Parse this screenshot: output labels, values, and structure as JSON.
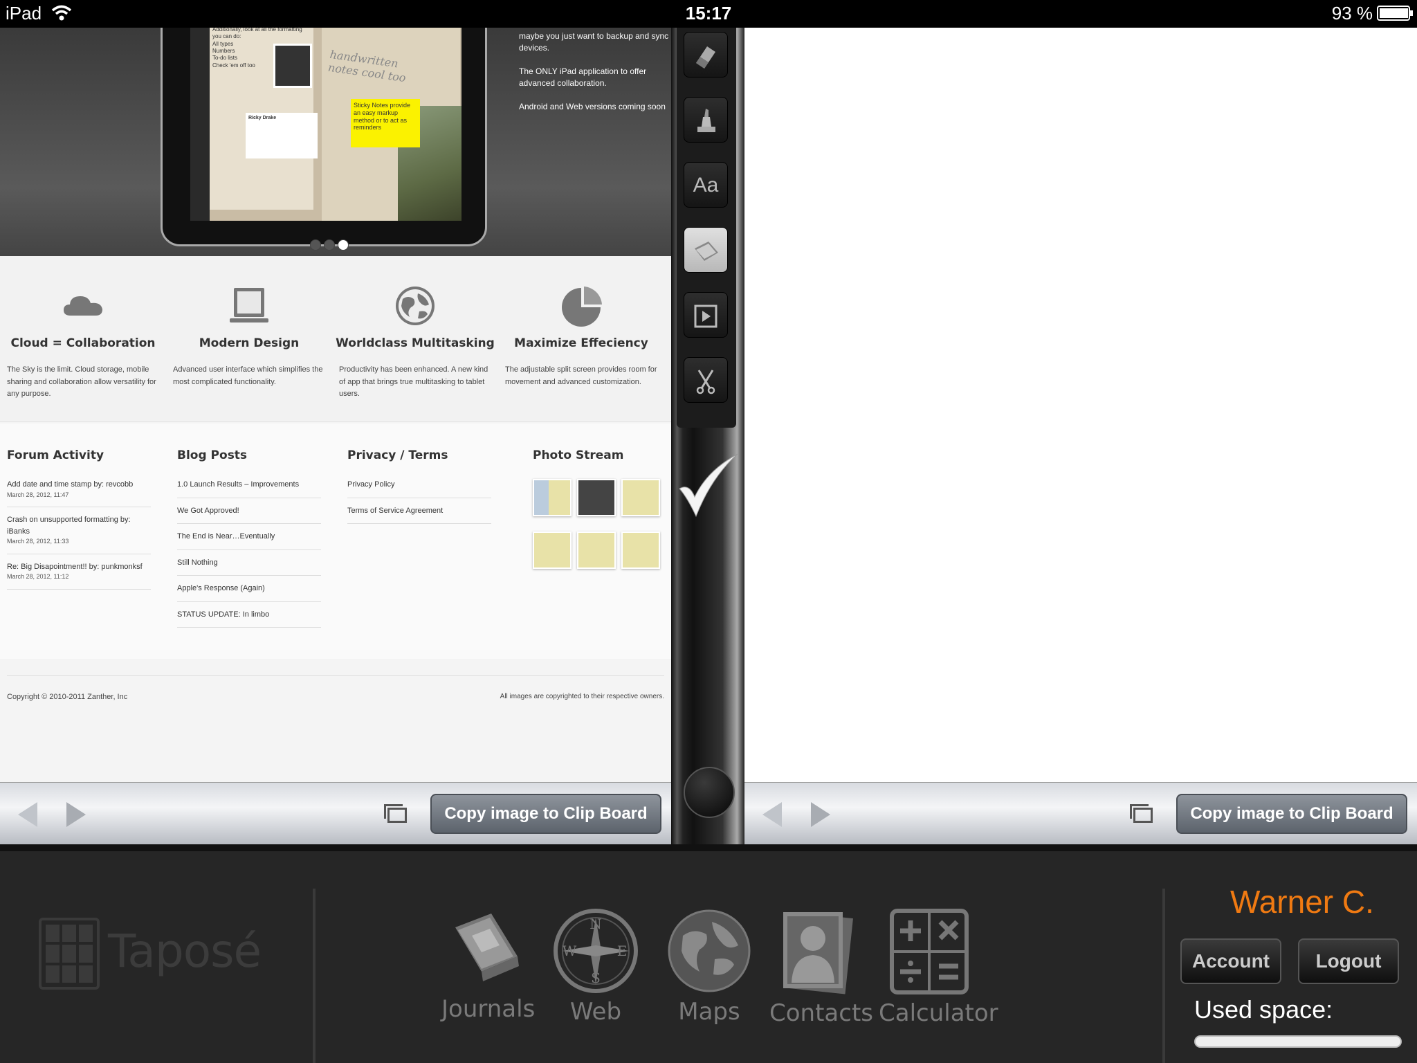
{
  "status_bar": {
    "device": "iPad",
    "time": "15:17",
    "battery_percent": "93 %",
    "battery_level": 0.93
  },
  "hero": {
    "text_lines": [
      "maybe you just want to backup and sync devices.",
      "The ONLY iPad application to offer advanced collaboration.",
      "Android and Web versions coming soon"
    ],
    "screen_page_text": "The Taposé word processor is one of the most powerful on the iPad. Additionally, look at all the formatting you can do:",
    "screen_list": [
      "All types",
      "Numbers",
      "To-do lists",
      "Check 'em off too"
    ],
    "screen_handwriting": "handwritten notes cool too",
    "screen_sticky": "Sticky Notes provide an easy markup method or to act as reminders",
    "screen_card_name": "Ricky Drake",
    "slide_count": 3,
    "active_slide": 3
  },
  "features": [
    {
      "title": "Cloud = Collaboration",
      "text": "The Sky is the limit. Cloud storage, mobile sharing and collaboration allow versatility for any purpose.",
      "icon": "cloud-icon"
    },
    {
      "title": "Modern Design",
      "text": "Advanced user interface which simplifies the most complicated functionality.",
      "icon": "laptop-icon"
    },
    {
      "title": "Worldclass Multitasking",
      "text": "Productivity has been enhanced. A new kind of app that brings true multitasking to tablet users.",
      "icon": "globe-icon"
    },
    {
      "title": "Maximize Effeciency",
      "text": "The adjustable split screen provides room for movement and advanced customization.",
      "icon": "pie-chart-icon"
    }
  ],
  "forum": {
    "heading": "Forum Activity",
    "items": [
      {
        "text": "Add date and time stamp by: revcobb",
        "time": "March 28, 2012, 11:47"
      },
      {
        "text": "Crash on unsupported formatting by: iBanks",
        "time": "March 28, 2012, 11:33"
      },
      {
        "text": "Re: Big Disapointment!! by: punkmonksf",
        "time": "March 28, 2012, 11:12"
      }
    ]
  },
  "blog": {
    "heading": "Blog Posts",
    "items": [
      "1.0 Launch Results – Improvements",
      "We Got Approved!",
      "The End is Near…Eventually",
      "Still Nothing",
      "Apple's Response (Again)",
      "STATUS UPDATE: In limbo"
    ]
  },
  "privacy": {
    "heading": "Privacy / Terms",
    "items": [
      "Privacy Policy",
      "Terms of Service Agreement"
    ]
  },
  "photo_stream": {
    "heading": "Photo Stream"
  },
  "footer": {
    "copyright": "Copyright © 2010-2011 Zanther, Inc",
    "rights": "All images are copyrighted to their respective owners."
  },
  "pane_toolbar": {
    "copy_label": "Copy image to Clip Board"
  },
  "tools": [
    "eraser-icon",
    "highlighter-icon",
    "text-tool-icon",
    "note-tool-icon",
    "media-tool-icon",
    "scissors-icon"
  ],
  "tool_text_label": "Aa",
  "dock": {
    "apps": [
      {
        "label": "Journals",
        "icon": "journals-icon"
      },
      {
        "label": "Web",
        "icon": "compass-icon"
      },
      {
        "label": "Maps",
        "icon": "globe-icon"
      },
      {
        "label": "Contacts",
        "icon": "contacts-icon"
      },
      {
        "label": "Calculator",
        "icon": "calculator-icon"
      }
    ],
    "logo_text": "Taposé",
    "user_name": "Warner C.",
    "account_label": "Account",
    "logout_label": "Logout",
    "used_space_label": "Used space:",
    "used_space_fraction": 0.0
  }
}
